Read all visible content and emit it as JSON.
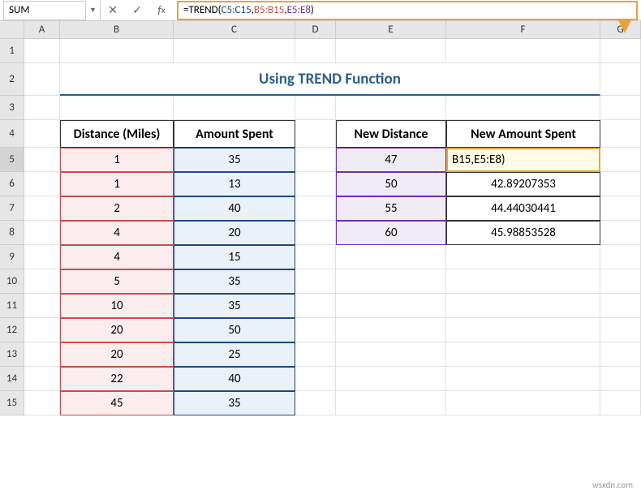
{
  "name_box": "SUM",
  "formula": {
    "prefix": "=TREND(",
    "arg1": "C5:C15",
    "sep1": ",",
    "arg2": "B5:B15",
    "sep2": ",",
    "arg3": "E5:E8",
    "suffix": ")"
  },
  "editing_cell_text": "B15,E5:E8)",
  "columns": [
    "A",
    "B",
    "C",
    "D",
    "E",
    "F",
    "G"
  ],
  "row_labels": [
    "1",
    "2",
    "3",
    "4",
    "5",
    "6",
    "7",
    "8",
    "9",
    "10",
    "11",
    "12",
    "13",
    "14",
    "15"
  ],
  "title": "Using TREND Function",
  "headers": {
    "distance": "Distance (Miles)",
    "amount": "Amount Spent",
    "new_distance": "New Distance",
    "new_amount": "New Amount Spent"
  },
  "table1": [
    {
      "d": "1",
      "a": "35"
    },
    {
      "d": "1",
      "a": "13"
    },
    {
      "d": "2",
      "a": "40"
    },
    {
      "d": "4",
      "a": "20"
    },
    {
      "d": "4",
      "a": "15"
    },
    {
      "d": "5",
      "a": "35"
    },
    {
      "d": "10",
      "a": "35"
    },
    {
      "d": "20",
      "a": "50"
    },
    {
      "d": "20",
      "a": "25"
    },
    {
      "d": "22",
      "a": "40"
    },
    {
      "d": "45",
      "a": "35"
    }
  ],
  "table2": [
    {
      "nd": "47",
      "na": ""
    },
    {
      "nd": "50",
      "na": "42.89207353"
    },
    {
      "nd": "55",
      "na": "44.44030441"
    },
    {
      "nd": "60",
      "na": "45.98853528"
    }
  ],
  "watermark": "wsxdn.com"
}
